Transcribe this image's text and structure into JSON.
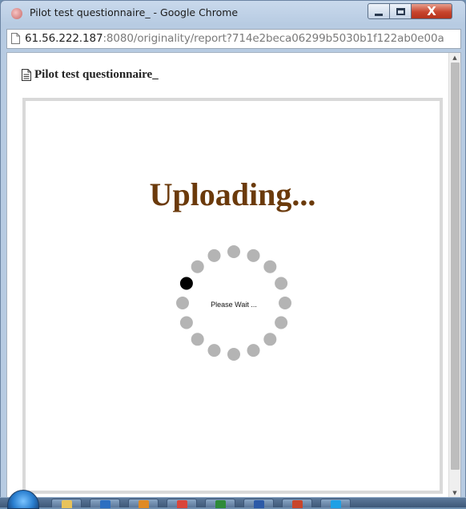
{
  "window": {
    "title": "Pilot test questionnaire_ - Google Chrome",
    "controls": {
      "minimize": "minimize",
      "maximize": "maximize",
      "close": "X"
    }
  },
  "address": {
    "host": "61.56.222.187",
    "rest": ":8080/originality/report?714e2beca06299b5030b1f122ab0e00a"
  },
  "page": {
    "doc_title": "Pilot test questionnaire_",
    "status_heading": "Uploading...",
    "wait_text": "Please Wait ...",
    "spinner": {
      "dot_count": 16,
      "active_dot_index": 13
    }
  },
  "taskbar": {
    "items": [
      {
        "icon": "explorer-icon",
        "color": "#e8c35a"
      },
      {
        "icon": "outlook-icon",
        "color": "#2c6fc1"
      },
      {
        "icon": "media-icon",
        "color": "#e08a24"
      },
      {
        "icon": "chrome-icon",
        "color": "#d9453b"
      },
      {
        "icon": "excel-icon",
        "color": "#2e8b3a"
      },
      {
        "icon": "word-icon",
        "color": "#2c5aa8"
      },
      {
        "icon": "powerpoint-icon",
        "color": "#c9452b"
      },
      {
        "icon": "skype-icon",
        "color": "#1ea0e6"
      }
    ]
  },
  "colors": {
    "heading": "#6b3a0b",
    "dot_inactive": "#b4b4b4",
    "dot_active": "#000000"
  }
}
